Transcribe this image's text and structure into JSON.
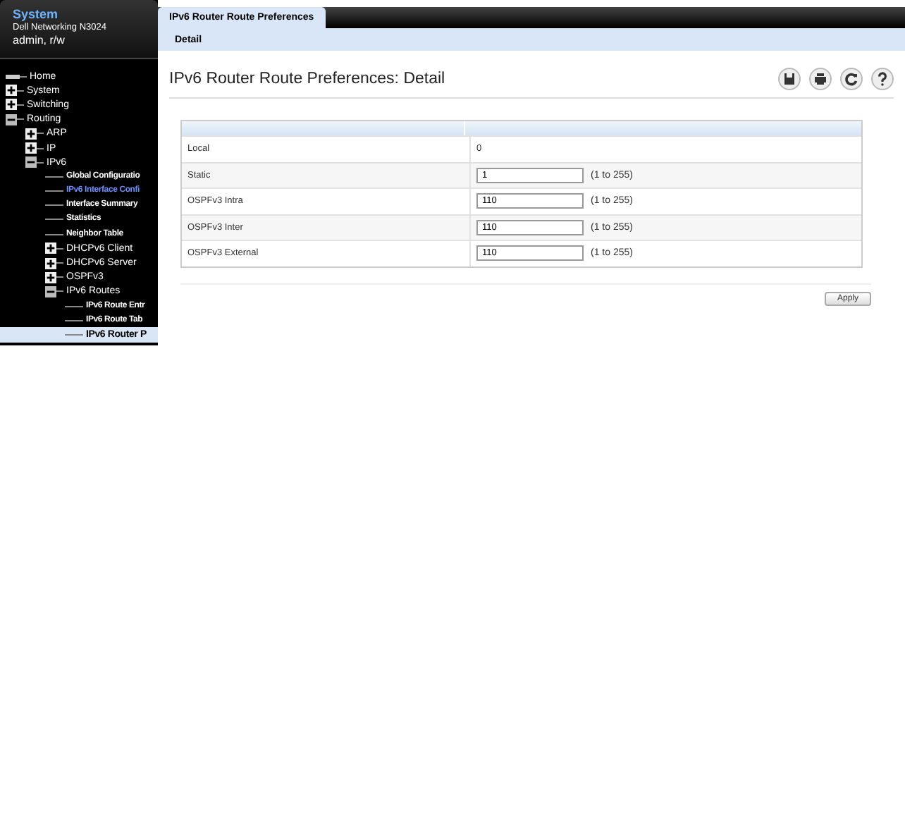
{
  "sidebar": {
    "title": "System",
    "device": "Dell Networking N3024",
    "user": "admin, r/w",
    "tree": [
      {
        "label": "Home",
        "kind": "home",
        "selected": false,
        "visited": false
      },
      {
        "label": "System",
        "kind": "folder",
        "expanded": false,
        "selected": false,
        "visited": false
      },
      {
        "label": "Switching",
        "kind": "folder",
        "expanded": false,
        "selected": false,
        "visited": false
      },
      {
        "label": "Routing",
        "kind": "folder",
        "expanded": true,
        "selected": false,
        "visited": false,
        "children": [
          {
            "label": "ARP",
            "kind": "folder",
            "expanded": false,
            "selected": false,
            "visited": false
          },
          {
            "label": "IP",
            "kind": "folder",
            "expanded": false,
            "selected": false,
            "visited": false
          },
          {
            "label": "IPv6",
            "kind": "folder",
            "expanded": true,
            "selected": false,
            "visited": false,
            "children": [
              {
                "label": "Global Configuratio",
                "kind": "page",
                "selected": false,
                "visited": false
              },
              {
                "label": "IPv6 Interface Confi",
                "kind": "page",
                "selected": false,
                "visited": true
              },
              {
                "label": "Interface Summary",
                "kind": "page",
                "selected": false,
                "visited": false
              },
              {
                "label": "Statistics",
                "kind": "page",
                "selected": false,
                "visited": false
              },
              {
                "label": "Neighbor Table",
                "kind": "page",
                "selected": false,
                "visited": false
              },
              {
                "label": "DHCPv6 Client",
                "kind": "folder",
                "expanded": false,
                "selected": false,
                "visited": false
              },
              {
                "label": "DHCPv6 Server",
                "kind": "folder",
                "expanded": false,
                "selected": false,
                "visited": false
              },
              {
                "label": "OSPFv3",
                "kind": "folder",
                "expanded": false,
                "selected": false,
                "visited": false
              },
              {
                "label": "IPv6 Routes",
                "kind": "folder",
                "expanded": true,
                "selected": false,
                "visited": false,
                "children": [
                  {
                    "label": "IPv6 Route Entr",
                    "kind": "page",
                    "selected": false,
                    "visited": false
                  },
                  {
                    "label": "IPv6 Route Tab",
                    "kind": "page",
                    "selected": false,
                    "visited": false
                  },
                  {
                    "label": "IPv6 Router P",
                    "kind": "page",
                    "selected": true,
                    "visited": false
                  }
                ]
              }
            ]
          }
        ]
      }
    ]
  },
  "tabs": [
    {
      "label": "IPv6 Router Route Preferences",
      "selected": true
    }
  ],
  "subtabs": [
    {
      "label": "Detail",
      "selected": true
    }
  ],
  "page_title": "IPv6 Router Route Preferences: Detail",
  "toolbar": [
    {
      "kind": "save"
    },
    {
      "kind": "print"
    },
    {
      "kind": "refresh"
    },
    {
      "kind": "help"
    }
  ],
  "rows": [
    {
      "label": "Local",
      "kind": "static",
      "value": "0"
    },
    {
      "label": "Static",
      "kind": "input",
      "value": "1",
      "range": "(1 to 255)"
    },
    {
      "label": "OSPFv3 Intra",
      "kind": "input",
      "value": "110",
      "range": "(1 to 255)"
    },
    {
      "label": "OSPFv3 Inter",
      "kind": "input",
      "value": "110",
      "range": "(1 to 255)"
    },
    {
      "label": "OSPFv3 External",
      "kind": "input",
      "value": "110",
      "range": "(1 to 255)"
    }
  ],
  "apply_button": "Apply"
}
